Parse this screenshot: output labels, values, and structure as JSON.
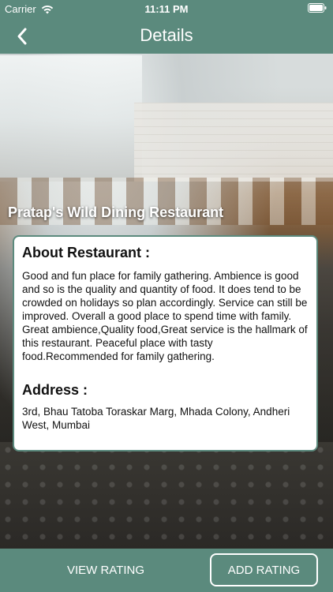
{
  "status_bar": {
    "carrier": "Carrier",
    "time": "11:11 PM",
    "wifi_icon": "wifi-icon",
    "battery_icon": "battery-icon"
  },
  "nav": {
    "title": "Details",
    "back_icon": "chevron-left-icon"
  },
  "restaurant": {
    "name": "Pratap's Wild Dining Restaurant"
  },
  "about": {
    "heading": "About Restaurant :",
    "text": "Good and fun place for family gathering. Ambience is good and so is the quality and quantity of food. It does tend to be crowded on holidays so plan accordingly. Service can still be improved. Overall a good place to spend time with family. Great ambience,Quality food,Great service is the hallmark of this restaurant. Peaceful place with tasty food.Recommended for family gathering."
  },
  "address": {
    "heading": "Address :",
    "text": "3rd, Bhau Tatoba Toraskar Marg, Mhada Colony, Andheri West, Mumbai"
  },
  "actions": {
    "view_rating": "VIEW RATING",
    "add_rating": "ADD RATING"
  },
  "colors": {
    "accent": "#5b8a7d",
    "card_bg": "#ffffff",
    "text": "#111111"
  }
}
